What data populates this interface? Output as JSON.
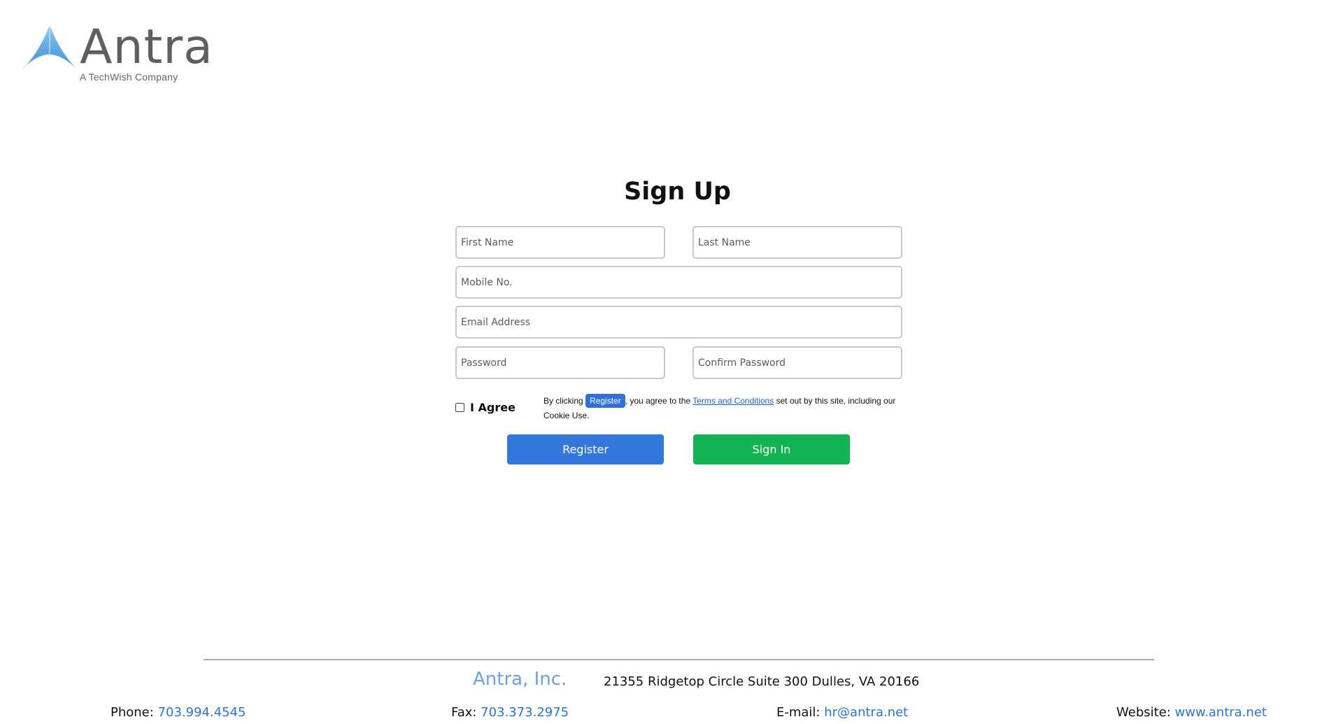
{
  "brand": {
    "name": "Antra",
    "tagline": "A TechWish Company"
  },
  "form": {
    "title": "Sign Up",
    "first_name_placeholder": "First Name",
    "last_name_placeholder": "Last Name",
    "mobile_placeholder": "Mobile No.",
    "email_placeholder": "Email Address",
    "password_placeholder": "Password",
    "confirm_password_placeholder": "Confirm Password",
    "agree_label": "I Agree",
    "agree_checked": false,
    "terms_prefix": "By clicking ",
    "terms_chip": "Register",
    "terms_middle": ", you agree to the ",
    "terms_link": "Terms and Conditions",
    "terms_suffix": " set out by this site, including our Cookie Use.",
    "register_label": "Register",
    "signin_label": "Sign In"
  },
  "footer": {
    "company": "Antra, Inc.",
    "address": "21355 Ridgetop Circle Suite 300 Dulles, VA 20166",
    "phone_label": "Phone: ",
    "phone": "703.994.4545",
    "fax_label": "Fax: ",
    "fax": "703.373.2975",
    "email_label": "E-mail: ",
    "email": "hr@antra.net",
    "website_label": "Website: ",
    "website": "www.antra.net"
  },
  "colors": {
    "register_button": "#3376dc",
    "signin_button": "#12b552",
    "link": "#2f74d0",
    "company": "#6ea0e2"
  },
  "icons": {
    "logo_mark": "antra-triangle-logo-icon",
    "checkbox": "checkbox-icon"
  }
}
